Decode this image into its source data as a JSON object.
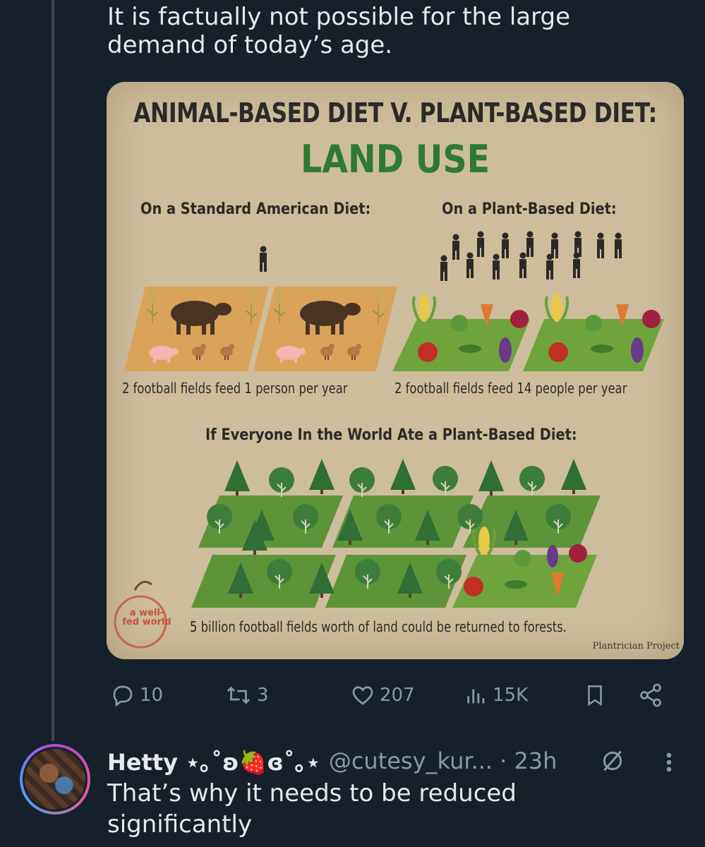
{
  "tweet": {
    "text": "It is factually not possible for the large demand of today’s age."
  },
  "infographic": {
    "title": "ANIMAL-BASED DIET V. PLANT-BASED DIET:",
    "subtitle": "LAND USE",
    "sad_label": "On a Standard American Diet:",
    "plant_label": "On a Plant-Based Diet:",
    "sad_caption": "2 football fields feed 1 person per year",
    "plant_caption": "2 football fields feed 14 people per year",
    "world_label": "If Everyone In the World Ate a Plant-Based Diet:",
    "world_caption": "5 billion football fields worth of land could be returned to forests.",
    "logo_text": "a well-fed world",
    "brand_text": "Plantrician Project"
  },
  "actions": {
    "replies": "10",
    "reposts": "3",
    "likes": "207",
    "views": "15K"
  },
  "reply": {
    "name": "Hetty ⋆｡˚ʚ🍓ɞ˚｡⋆",
    "handle": "@cutesy_kur...",
    "time": "· 23h",
    "text": "That’s why it needs to be reduced significantly"
  },
  "colors": {
    "background": "#15202b",
    "text": "#e7e9ea",
    "muted": "#8b98a5",
    "card_bg": "#cdbd9c",
    "green": "#2f7a33"
  }
}
